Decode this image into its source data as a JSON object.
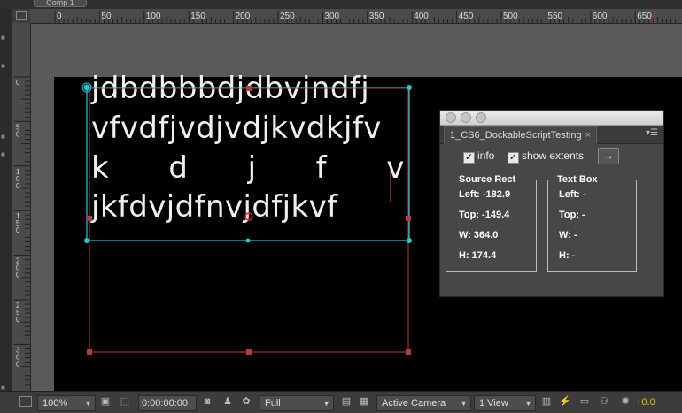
{
  "window": {
    "comp_tab": "Comp 1"
  },
  "rulers": {
    "horizontal_ticks": [
      "0",
      "50",
      "100",
      "150",
      "200",
      "250",
      "300",
      "350",
      "400",
      "450",
      "500",
      "550",
      "600",
      "650"
    ],
    "vertical_ticks": [
      "0",
      "50",
      "100",
      "150",
      "200",
      "250",
      "300"
    ]
  },
  "composition": {
    "text_lines": [
      "jdbdbbbdjdbvjndfj",
      "vfvdfjvdjvdjkvdkjfv",
      "k      d      j      f      v",
      "jkfdvjdfnvjdfjkvf"
    ],
    "colors": {
      "text_box": "#25c6d8",
      "source_rect": "#b83a3a",
      "canvas": "#000000"
    }
  },
  "panel": {
    "tab_title": "1_CS6_DockableScriptTesting",
    "tab_close": "×",
    "menu_glyph": "▾☰",
    "checkbox_info": {
      "label": "info",
      "checked": true
    },
    "checkbox_extents": {
      "label": "show extents",
      "checked": true
    },
    "arrow_button": "→",
    "source_rect": {
      "title": "Source Rect",
      "left": "Left: -182.9",
      "top": "Top: -149.4",
      "width": "W: 364.0",
      "height": "H: 174.4"
    },
    "text_box": {
      "title": "Text Box",
      "left": "Left: -",
      "top": "Top: -",
      "width": "W: -",
      "height": "H: -"
    }
  },
  "bottombar": {
    "zoom": "100%",
    "timecode": "0:00:00:00",
    "resolution": "Full",
    "camera": "Active Camera",
    "views": "1 View",
    "exposure": "+0.0"
  }
}
